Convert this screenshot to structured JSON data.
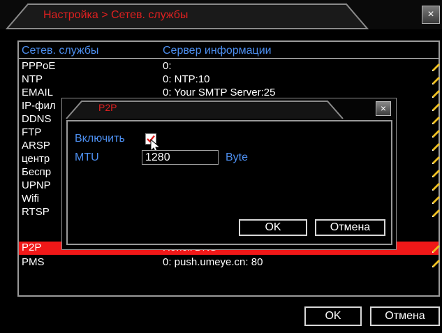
{
  "window": {
    "title": "Настройка > Сетев. службы",
    "close_glyph": "×"
  },
  "table": {
    "headers": [
      "Сетев. службы",
      "Сервер информации"
    ],
    "rows": [
      {
        "service": "PPPoE",
        "info": "0:"
      },
      {
        "service": "NTP",
        "info": "0: NTP:10"
      },
      {
        "service": "EMAIL",
        "info": "0: Your SMTP Server:25"
      },
      {
        "service": "IP-фил",
        "info": ""
      },
      {
        "service": "DDNS",
        "info": ""
      },
      {
        "service": "FTP",
        "info": ""
      },
      {
        "service": "ARSP",
        "info": ""
      },
      {
        "service": "центр",
        "info": ""
      },
      {
        "service": "Беспр",
        "info": ""
      },
      {
        "service": "UPNP",
        "info": ""
      },
      {
        "service": "Wifi",
        "info": ""
      },
      {
        "service": "RTSP",
        "info": ""
      },
      {
        "service": "P2P",
        "info": "Поиск DNS",
        "selected": true
      },
      {
        "service": "PMS",
        "info": "0: push.umeye.cn: 80"
      }
    ]
  },
  "buttons": {
    "ok": "OK",
    "cancel": "Отмена"
  },
  "dialog": {
    "title": "P2P",
    "close_glyph": "×",
    "enable_label": "Включить",
    "enable_checked": true,
    "mtu_label": "MTU",
    "mtu_value": "1280",
    "mtu_unit": "Byte",
    "ok": "OK",
    "cancel": "Отмена"
  },
  "colors": {
    "background": "#000000",
    "label_blue": "#4d8ff0",
    "title_red": "#e02020",
    "selection_red": "#f01818",
    "pencil_yellow": "#f0c020"
  },
  "icons": {
    "edit": "pencil-icon",
    "checkbox": "checkmark-icon",
    "cursor": "mouse-cursor-icon"
  }
}
